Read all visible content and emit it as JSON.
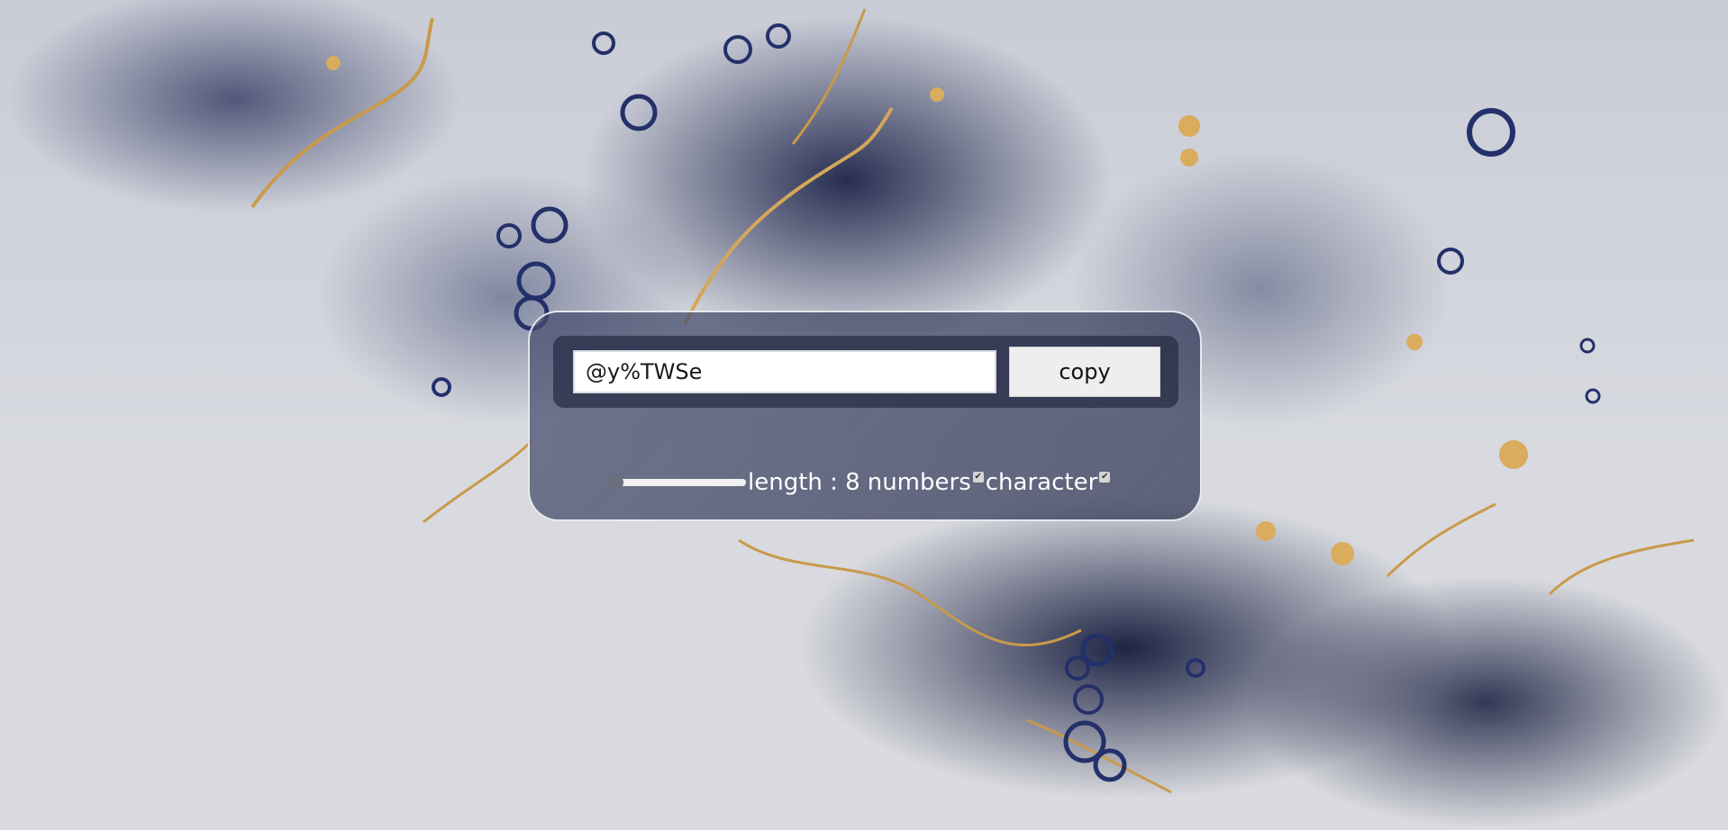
{
  "password": {
    "value": "@y%TWSe"
  },
  "copy_button": {
    "label": "copy"
  },
  "length": {
    "label": "length : 8",
    "value": 8
  },
  "options": {
    "numbers_label": "numbers",
    "numbers_checked": true,
    "character_label": "character",
    "character_checked": true
  },
  "colors": {
    "accent": "#2b3560"
  }
}
